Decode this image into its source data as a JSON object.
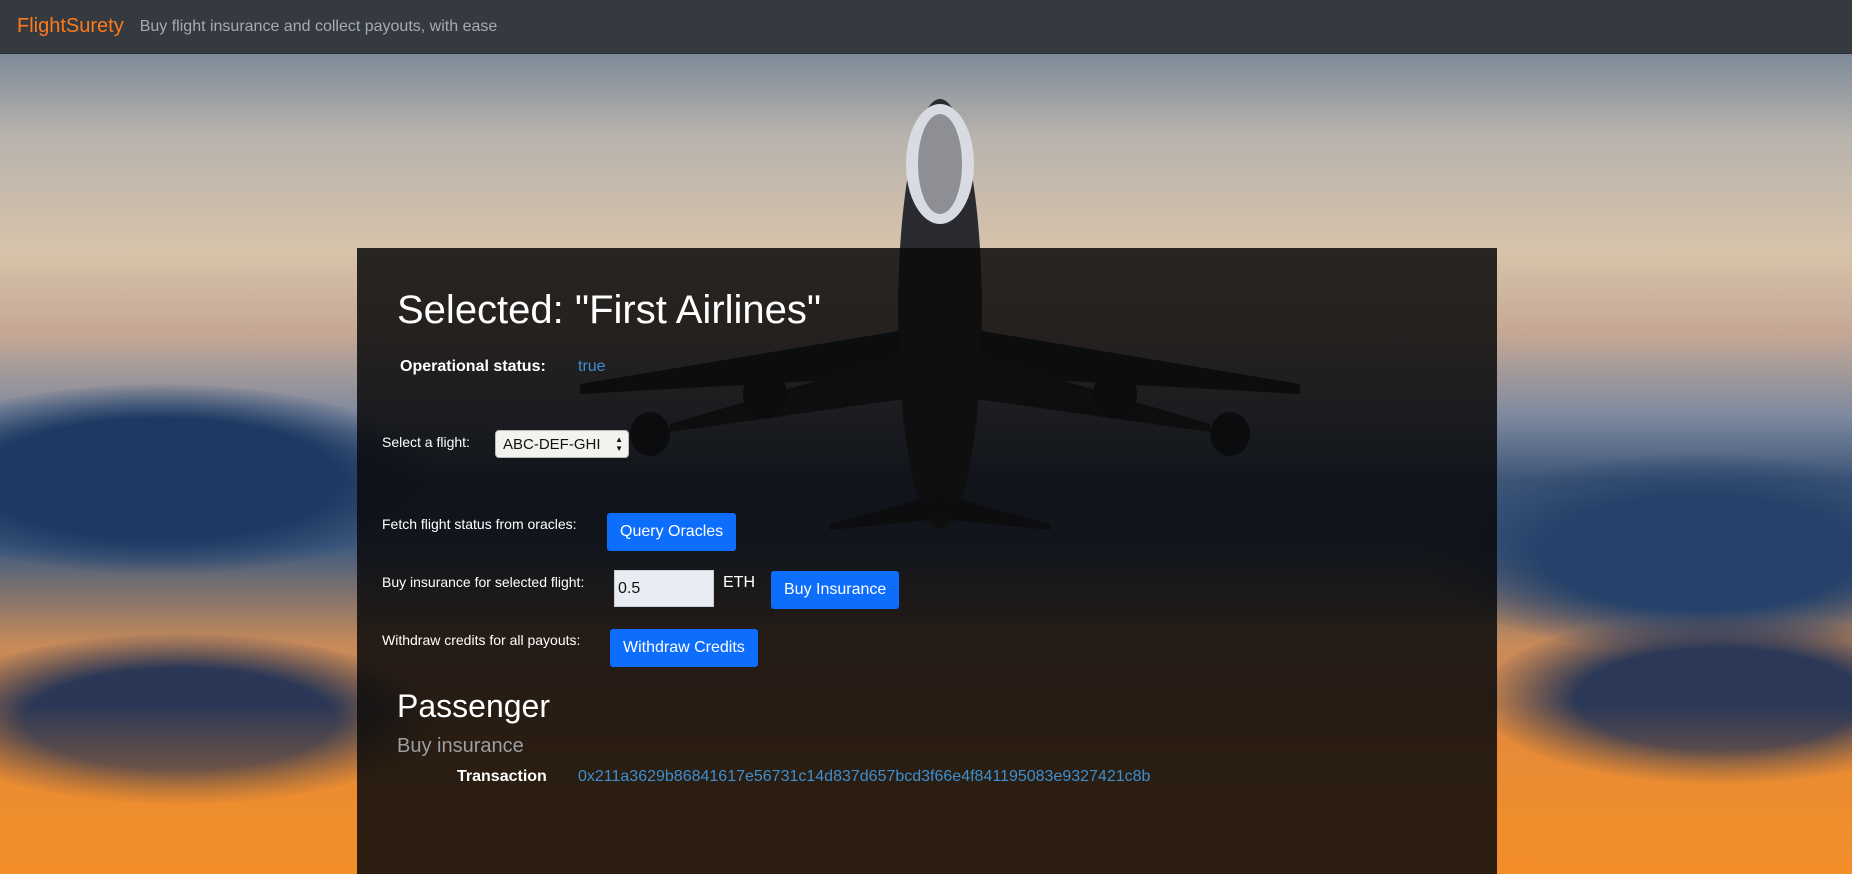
{
  "navbar": {
    "brand": "FlightSurety",
    "tagline": "Buy flight insurance and collect payouts, with ease",
    "brand_color": "#ff7a1a"
  },
  "panel": {
    "title": "Selected: \"First Airlines\"",
    "operational_status_label": "Operational status:",
    "operational_status_value": "true",
    "select_flight_label": "Select a flight:",
    "selected_flight": "ABC-DEF-GHI",
    "fetch_status_label": "Fetch flight status from oracles:",
    "query_oracles_button": "Query Oracles",
    "buy_insurance_label": "Buy insurance for selected flight:",
    "amount_value": "0.5",
    "amount_unit": "ETH",
    "buy_insurance_button": "Buy Insurance",
    "withdraw_label": "Withdraw credits for all payouts:",
    "withdraw_button": "Withdraw Credits"
  },
  "passenger": {
    "title": "Passenger",
    "subtitle": "Buy insurance",
    "transaction_label": "Transaction",
    "transaction_hash": "0x211a3629b86841617e56731c14d837d657bcd3f66e4f841195083e9327421c8b"
  },
  "colors": {
    "accent_button": "#0d6efd",
    "status_value": "#3d8fd1",
    "navbar_bg": "#343a40"
  },
  "icons": {
    "select_arrows": "up-down-arrows-icon"
  }
}
